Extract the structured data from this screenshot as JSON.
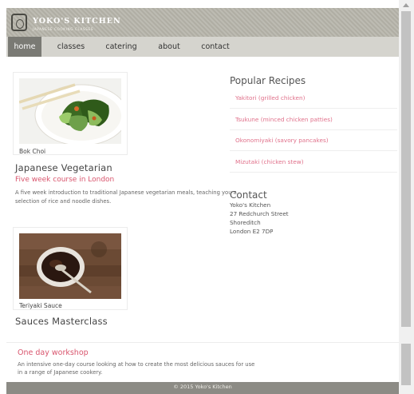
{
  "header": {
    "title": "YOKO'S KITCHEN",
    "subtitle": "JAPANESE COOKING CLASSES"
  },
  "nav": {
    "items": [
      {
        "label": "home",
        "active": true
      },
      {
        "label": "classes",
        "active": false
      },
      {
        "label": "catering",
        "active": false
      },
      {
        "label": "about",
        "active": false
      },
      {
        "label": "contact",
        "active": false
      }
    ]
  },
  "articles": [
    {
      "caption": "Bok Choi",
      "title": "Japanese Vegetarian",
      "subtitle": "Five week course in London",
      "description": "A five week introduction to traditional Japanese vegetarian meals, teaching you a selection of rice and noodle dishes."
    },
    {
      "caption": "Teriyaki Sauce",
      "title": "Sauces Masterclass",
      "subtitle": "One day workshop",
      "description": "An intensive one-day course looking at how to create the most delicious sauces for use in a range of Japanese cookery."
    }
  ],
  "sidebar": {
    "recipes_title": "Popular Recipes",
    "recipes": [
      "Yakitori (grilled chicken)",
      "Tsukune (minced chicken patties)",
      "Okonomiyaki (savory pancakes)",
      "Mizutaki (chicken stew)"
    ],
    "contact_title": "Contact",
    "contact_lines": [
      "Yoko's Kitchen",
      "27 Redchurch Street",
      "Shoreditch",
      "London E2 7DP"
    ]
  },
  "footer": {
    "text": "© 2015 Yoko's Kitchen"
  }
}
